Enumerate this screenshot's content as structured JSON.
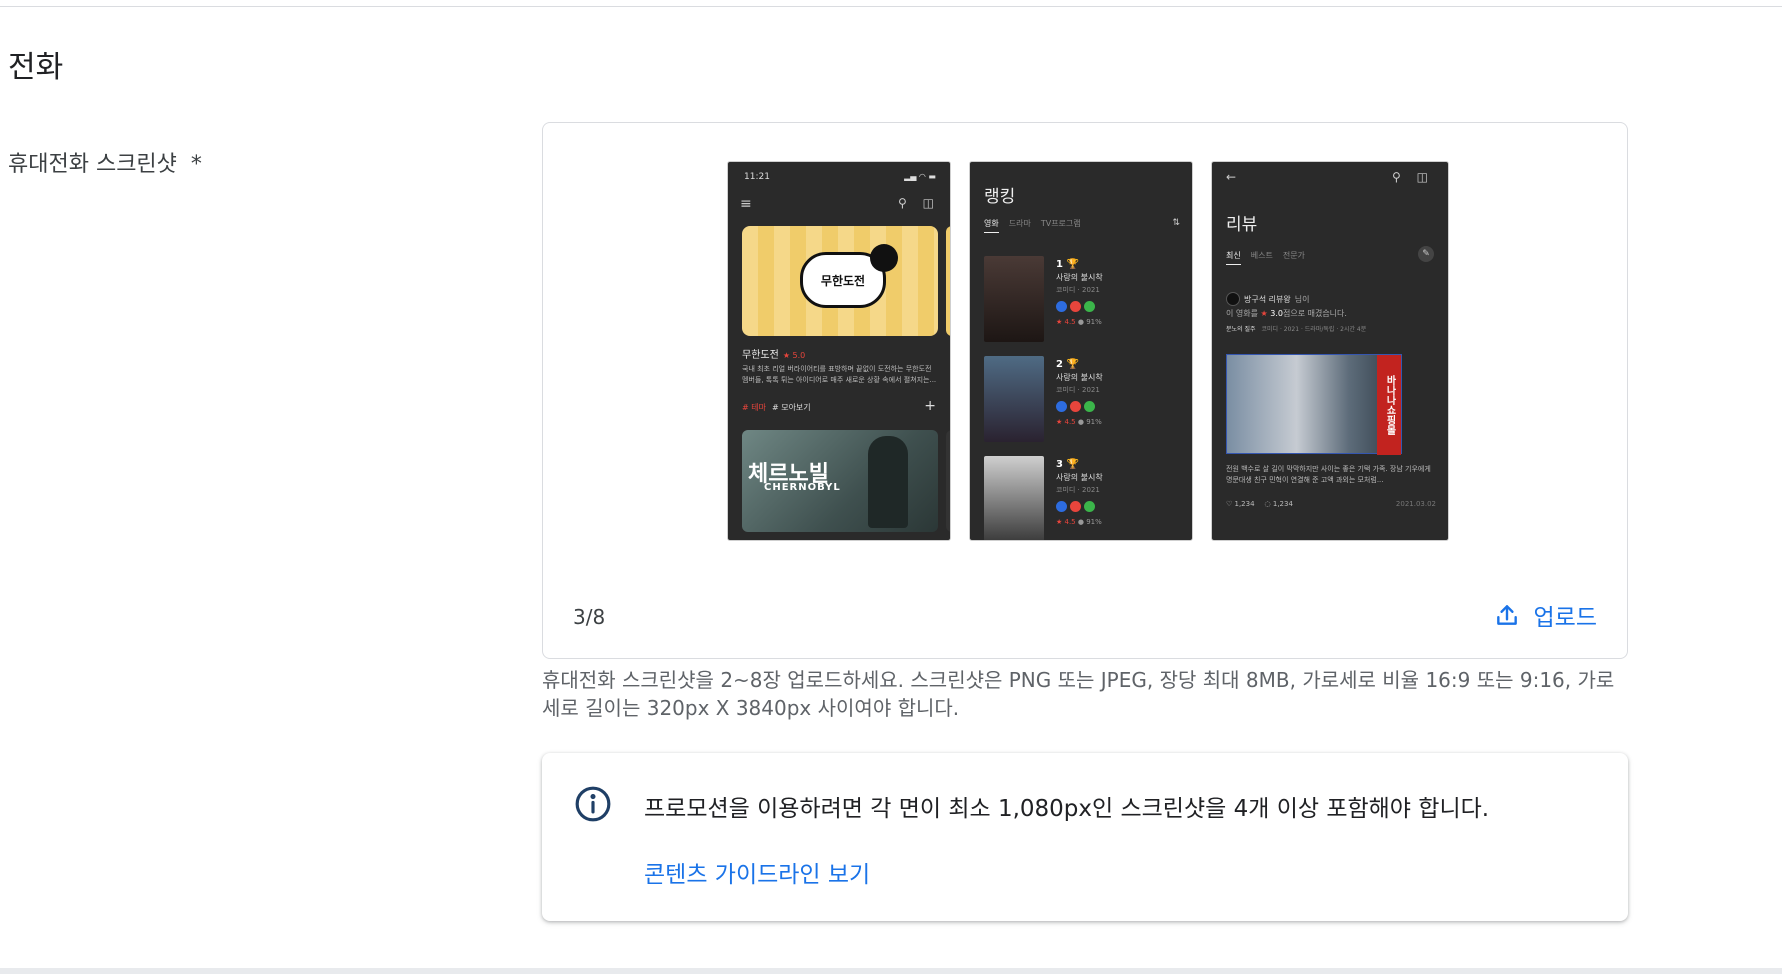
{
  "section": {
    "title": "전화"
  },
  "field": {
    "label": "휴대전화 스크린샷",
    "required_mark": "*"
  },
  "gallery": {
    "counter": "3/8",
    "upload_label": "업로드",
    "phone1": {
      "status_time": "11:21",
      "status_icons": "▂▄ ◠ ▬",
      "menu_glyph": "≡",
      "top_icons": "⚲ ◫",
      "banner_text": "무한도전",
      "show_title": "무한도전",
      "rating": "★ 5.0",
      "desc": "국내 최초 리얼 버라이어티를 표방하며 끝없이 도전하는 무한도전 멤버들, 톡톡 튀는 아이디어로 매주 새로운 상황 속에서 펼쳐지는...",
      "tag_red": "# 테마",
      "tag": "# 모아보기",
      "plus": "+",
      "poster_title": "체르노빌",
      "poster_sub": "CHERNOBYL"
    },
    "phone2": {
      "title": "랭킹",
      "tabs": [
        "영화",
        "드라마",
        "TV프로그램"
      ],
      "filter_glyph": "⇅",
      "rows": [
        {
          "num": "1 🏆",
          "name": "사랑의 불시착",
          "meta": "코미디 · 2021",
          "stat_star": "★ 4.5",
          "stat_pct": "● 91%"
        },
        {
          "num": "2 🏆",
          "name": "사랑의 불시착",
          "meta": "코미디 · 2021",
          "stat_star": "★ 4.5",
          "stat_pct": "● 91%"
        },
        {
          "num": "3 🏆",
          "name": "사랑의 불시착",
          "meta": "코미디 · 2021",
          "stat_star": "★ 4.5",
          "stat_pct": "● 91%"
        }
      ],
      "dot_colors": [
        "#2d6cdf",
        "#e8453c",
        "#3bb54a"
      ]
    },
    "phone3": {
      "back_glyph": "←",
      "top_icons": "⚲ ◫",
      "title": "리뷰",
      "tabs": [
        "최신",
        "베스트",
        "전문가"
      ],
      "edit_glyph": "✎",
      "user": "방구석 리뷰왕",
      "user_suffix": "님이",
      "rate_prefix": "이 영화를",
      "rate_star": "★",
      "rate_value": "3.0",
      "rate_suffix": "점으로 매겼습니다.",
      "meta_title": "분노의 질주",
      "meta_info": "코미디 · 2021 · 드라마/독립 · 2시간 4분",
      "sign_text": "바나나쇼핑몰",
      "desc": "전원 백수로 살 길이 막막하지만 사이는 좋은 기택 가족. 장남 기우에게 명문대생 친구 민혁이 연결해 준 고액 과외는 모처럼...",
      "likes": "♡ 1,234",
      "comments": "◌ 1,234",
      "date": "2021.03.02"
    }
  },
  "helper_text": "휴대전화 스크린샷을 2~8장 업로드하세요. 스크린샷은 PNG 또는 JPEG, 장당 최대 8MB, 가로세로 비율 16:9 또는 9:16, 가로세로 길이는 320px X 3840px 사이여야 합니다.",
  "info": {
    "message": "프로모션을 이용하려면 각 면이 최소 1,080px인 스크린샷을 4개 이상 포함해야 합니다.",
    "link": "콘텐츠 가이드라인 보기",
    "icon_color": "#1f3f66"
  },
  "colors": {
    "accent": "#1a73e8"
  }
}
